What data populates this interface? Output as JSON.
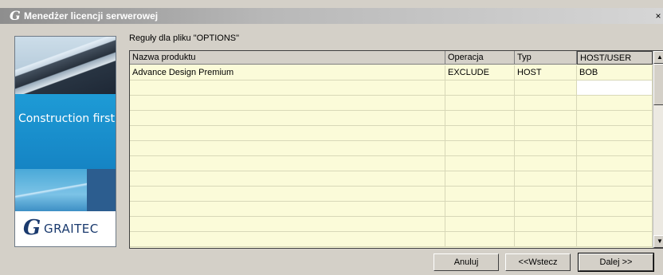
{
  "window": {
    "title": "Menedżer licencji serwerowej",
    "title_icon": "G",
    "close": "×"
  },
  "side_panel": {
    "slogan": "Construction first",
    "logo_mark": "G",
    "logo_text": "GRAITEC"
  },
  "rules_label": "Reguły dla pliku \"OPTIONS\"",
  "grid": {
    "columns": [
      "Nazwa produktu",
      "Operacja",
      "Typ",
      "HOST/USER"
    ],
    "rows": [
      [
        "Advance Design Premium",
        "EXCLUDE",
        "HOST",
        "BOB"
      ],
      [
        "",
        "",
        "",
        ""
      ],
      [
        "",
        "",
        "",
        ""
      ],
      [
        "",
        "",
        "",
        ""
      ],
      [
        "",
        "",
        "",
        ""
      ],
      [
        "",
        "",
        "",
        ""
      ],
      [
        "",
        "",
        "",
        ""
      ],
      [
        "",
        "",
        "",
        ""
      ],
      [
        "",
        "",
        "",
        ""
      ],
      [
        "",
        "",
        "",
        ""
      ],
      [
        "",
        "",
        "",
        ""
      ],
      [
        "",
        "",
        "",
        ""
      ]
    ],
    "scroll_up": "▲",
    "scroll_down": "▼"
  },
  "buttons": {
    "cancel": "Anuluj",
    "back": "<<Wstecz",
    "next": "Dalej >>"
  }
}
